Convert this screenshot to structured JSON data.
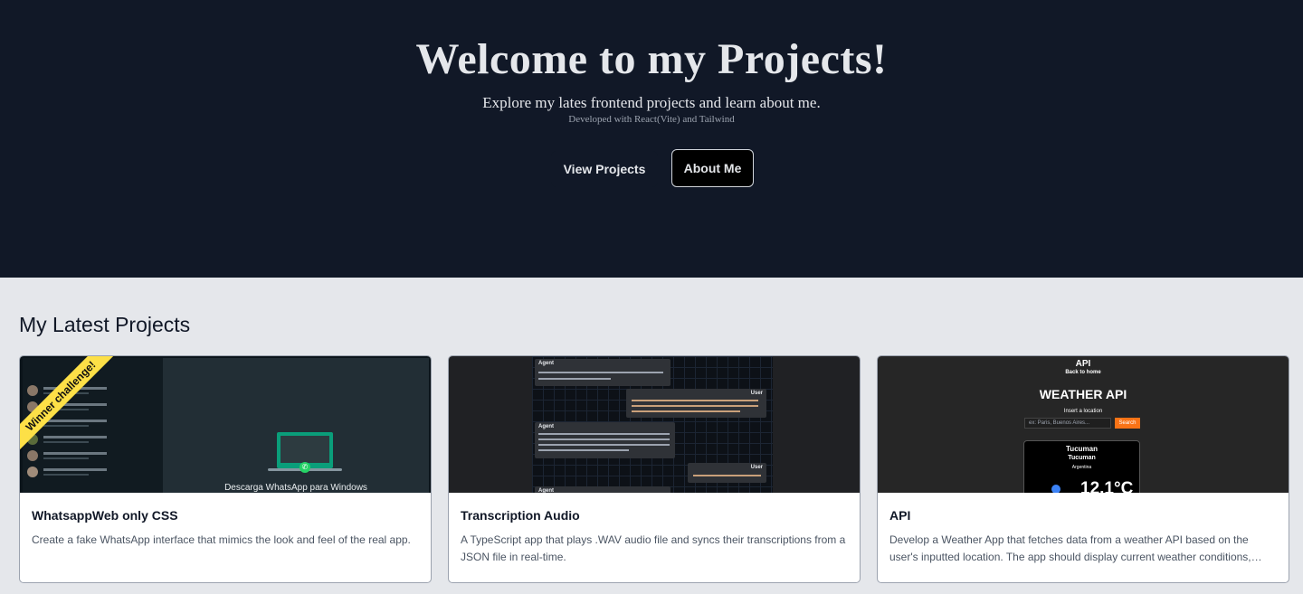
{
  "hero": {
    "title": "Welcome to my Projects!",
    "subtitle": "Explore my lates frontend projects and learn about me.",
    "developed": "Developed with React(Vite) and Tailwind",
    "view_projects_label": "View Projects",
    "about_me_label": "About Me"
  },
  "section": {
    "title": "My Latest Projects"
  },
  "cards": [
    {
      "title": "WhatsappWeb only CSS",
      "description": "Create a fake WhatsApp interface that mimics the look and feel of the real app.",
      "ribbon": "Winner challenge!",
      "thumb_text": "Descarga WhatsApp para Windows"
    },
    {
      "title": "Transcription Audio",
      "description": "A TypeScript app that plays .WAV audio file and syncs their transcriptions from a JSON file in real-time.",
      "agent_label": "Agent",
      "user_label": "User"
    },
    {
      "title": "API",
      "description": "Develop a Weather App that fetches data from a weather API based on the user's inputted location. The app should display current weather conditions, including temperature, humidity, and wind speed.",
      "thumb_title": "API",
      "thumb_home": "Back to home",
      "thumb_heading": "WEATHER API",
      "thumb_insert": "Insert a location",
      "thumb_placeholder": "ex: Paris, Buenos Aires...",
      "thumb_search": "Search",
      "thumb_city": "Tucuman",
      "thumb_region": "Tucuman",
      "thumb_country": "Argentina",
      "thumb_temp": "12.1°C"
    }
  ],
  "colors": {
    "hero_bg": "#111827",
    "page_bg": "#e5e7eb",
    "ribbon": "#fde047",
    "search_btn": "#f97316"
  }
}
